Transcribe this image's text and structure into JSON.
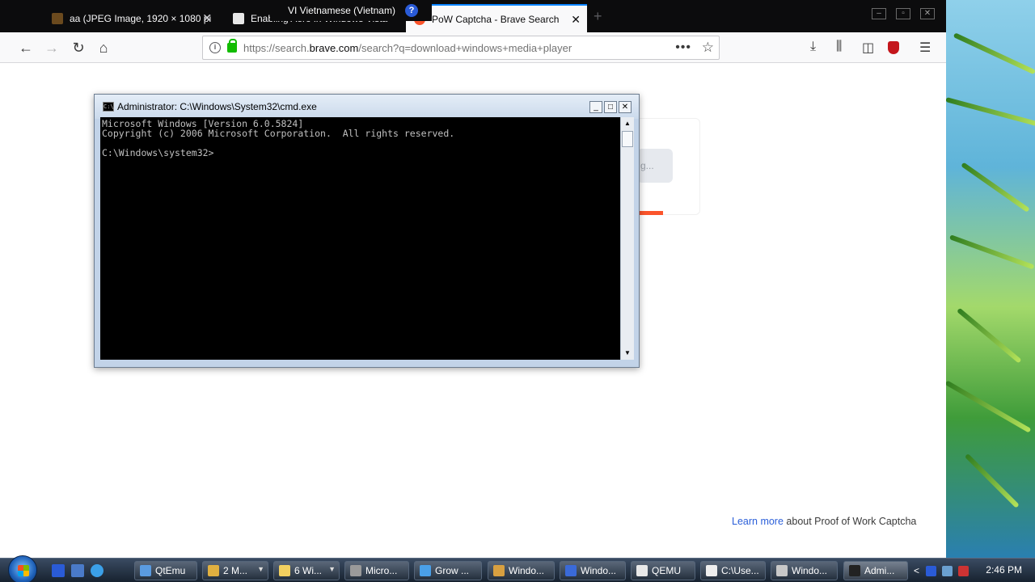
{
  "browser": {
    "tabs": [
      {
        "title": "aa (JPEG Image, 1920 × 1080 pi",
        "close": "✕"
      },
      {
        "title": "Enabling Aero in Windows Vista",
        "close": "✕"
      },
      {
        "title": "PoW Captcha - Brave Search",
        "close": "✕"
      }
    ],
    "new_tab": "+",
    "ime_popup": {
      "label": "VI Vietnamese (Vietnam)",
      "help": "?"
    },
    "url": {
      "prefix": "https://search.",
      "host": "brave.com",
      "path": "/search?q=download+windows+media+player"
    },
    "page_actions": "•••"
  },
  "page": {
    "captcha_button_text": "g...",
    "learn_more_link": "Learn more",
    "learn_more_rest": " about Proof of Work Captcha"
  },
  "cmd": {
    "title": "Administrator: C:\\Windows\\System32\\cmd.exe",
    "lines": "Microsoft Windows [Version 6.0.5824]\nCopyright (c) 2006 Microsoft Corporation.  All rights reserved.\n\nC:\\Windows\\system32>"
  },
  "taskbar": {
    "items": [
      {
        "label": "QtEmu",
        "color": "#5a9be0"
      },
      {
        "label": "2 M...",
        "color": "#e0b040"
      },
      {
        "label": "6 Wi...",
        "color": "#f2d060"
      },
      {
        "label": "Micro...",
        "color": "#9a9a9a"
      },
      {
        "label": "Grow ...",
        "color": "#4aa0e8"
      },
      {
        "label": "Windo...",
        "color": "#d8a040"
      },
      {
        "label": "Windo...",
        "color": "#3a6ad8"
      },
      {
        "label": "QEMU",
        "color": "#e8e8e8"
      },
      {
        "label": "C:\\Use...",
        "color": "#eeeeee"
      },
      {
        "label": "Windo...",
        "color": "#c8c8c8"
      },
      {
        "label": "Admi...",
        "color": "#222222"
      }
    ],
    "clock": "2:46 PM",
    "tray_arrow": "<"
  },
  "colors": {
    "accent": "#0a84ff",
    "brave_orange": "#fb542b",
    "link": "#2b5fd9"
  }
}
